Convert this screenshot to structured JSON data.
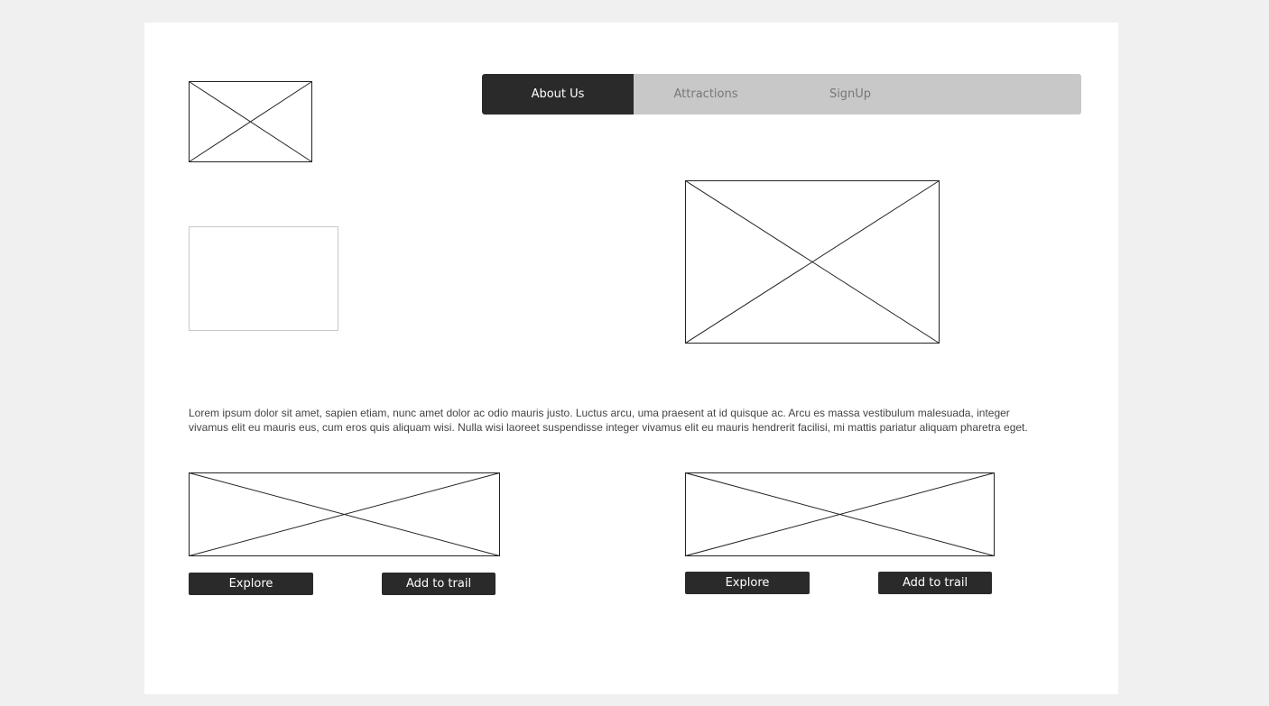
{
  "nav": {
    "tabs": [
      {
        "label": "About Us",
        "active": true
      },
      {
        "label": "Attractions",
        "active": false
      },
      {
        "label": "SignUp",
        "active": false
      }
    ]
  },
  "intro": {
    "text": "Lorem ipsum dolor sit amet, sapien etiam, nunc amet dolor ac odio mauris justo. Luctus arcu, uma praesent at id quisque ac. Arcu es massa vestibulum malesuada, integer vivamus elit eu mauris eus, cum eros quis aliquam wisi. Nulla wisi laoreet suspendisse integer vivamus elit eu mauris hendrerit facilisi, mi mattis pariatur aliquam pharetra eget."
  },
  "cards": [
    {
      "explore_label": "Explore",
      "add_label": "Add to trail"
    },
    {
      "explore_label": "Explore",
      "add_label": "Add to trail"
    }
  ],
  "colors": {
    "page_bg": "#f0f0f0",
    "canvas_bg": "#ffffff",
    "nav_bg": "#c8c8c8",
    "nav_active_bg": "#2a2a2a",
    "button_bg": "#2a2a2a",
    "placeholder_stroke": "#222222"
  }
}
